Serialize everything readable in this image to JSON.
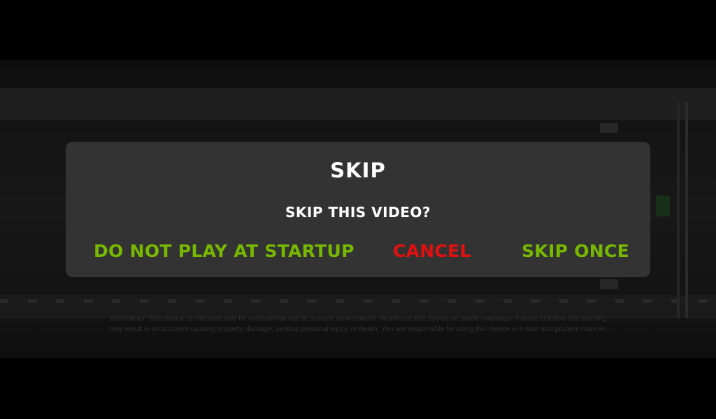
{
  "background": {
    "warning_text": "WARNING: This device is intended only for recreational use in a circuit environment. Never use this device on public roadways. Failure to follow this warning may result in an accident causing property damage, serious personal injury, or death. You are responsible for using this device in a safe and prudent manner."
  },
  "dialog": {
    "title": "SKIP",
    "message": "SKIP THIS VIDEO?",
    "buttons": {
      "do_not_play": "DO NOT PLAY AT STARTUP",
      "cancel": "CANCEL",
      "skip_once": "SKIP ONCE"
    }
  },
  "colors": {
    "accent_green": "#76b900",
    "cancel_red": "#e41010",
    "dialog_bg": "#333333"
  }
}
